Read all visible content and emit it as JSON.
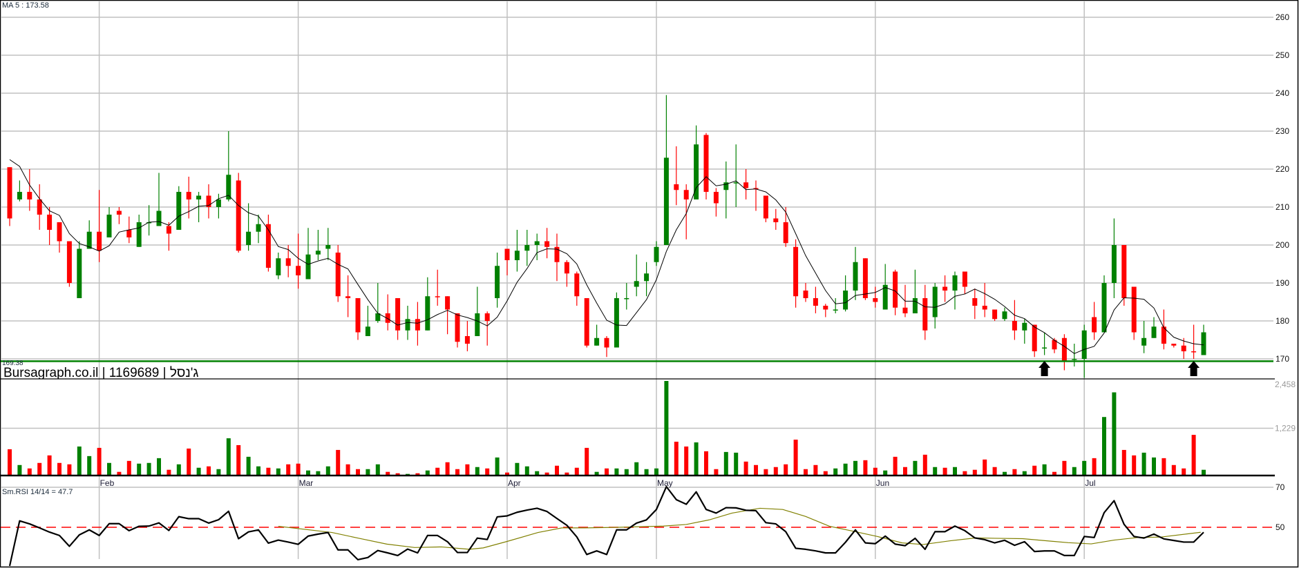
{
  "header": {
    "ma_label": "MA 5 : 173.58",
    "rsi_label": "Sm.RSI 14/14 = 47.7",
    "level_label": "169.38",
    "title": "Bursagraph.co.il | 1169689 | ג'נסל"
  },
  "colors": {
    "up": "#008000",
    "down": "#ff0000",
    "grid": "#c0c0c0",
    "ma": "#000000",
    "support": "#008000",
    "rsi": "#000000",
    "rsi_signal": "#808000",
    "rsi_ref": "#ff0000"
  },
  "chart_data": {
    "type": "candlestick",
    "price_axis": {
      "ticks": [
        170,
        180,
        190,
        200,
        210,
        220,
        230,
        240,
        250,
        260
      ],
      "range": [
        165,
        264
      ]
    },
    "volume_axis": {
      "ticks": [
        {
          "value": 1229,
          "label": "1,229"
        },
        {
          "value": 2458,
          "label": "2,458"
        }
      ],
      "range": [
        0,
        2458
      ]
    },
    "rsi_axis": {
      "ticks": [
        {
          "value": 70,
          "label": "70"
        },
        {
          "value": 50,
          "label": "50"
        }
      ],
      "reference": 50,
      "range": [
        30,
        74
      ]
    },
    "months": [
      {
        "label": "Feb",
        "index": 9
      },
      {
        "label": "Mar",
        "index": 29
      },
      {
        "label": "Apr",
        "index": 50
      },
      {
        "label": "May",
        "index": 65
      },
      {
        "label": "Jun",
        "index": 87
      },
      {
        "label": "Jul",
        "index": 108
      }
    ],
    "support_level": 169.38,
    "arrows_at_index": [
      104,
      119
    ],
    "ohlc_fields": [
      "open",
      "high",
      "low",
      "close"
    ],
    "ohlc": [
      [
        220.5,
        220.5,
        205,
        207
      ],
      [
        212,
        217,
        211.5,
        214
      ],
      [
        214,
        220,
        209,
        212
      ],
      [
        212,
        216,
        204,
        208
      ],
      [
        208,
        210,
        200,
        204
      ],
      [
        206,
        206,
        198,
        201
      ],
      [
        201,
        201,
        189,
        190
      ],
      [
        186,
        201,
        186,
        199
      ],
      [
        199,
        206.5,
        199,
        203.5
      ],
      [
        203.5,
        214.5,
        195.5,
        198.5
      ],
      [
        202,
        210,
        202,
        208
      ],
      [
        209,
        210,
        205.5,
        208
      ],
      [
        204,
        207.5,
        200.5,
        202
      ],
      [
        199.5,
        208,
        199.5,
        206
      ],
      [
        206,
        210.5,
        202.5,
        206
      ],
      [
        205,
        219,
        205,
        209
      ],
      [
        205,
        206,
        198.5,
        203
      ],
      [
        204,
        215.5,
        204,
        214
      ],
      [
        214,
        218,
        207,
        212
      ],
      [
        212,
        214,
        206,
        213
      ],
      [
        213,
        216,
        207,
        210
      ],
      [
        210,
        213.5,
        207,
        212
      ],
      [
        212,
        230,
        211.5,
        218.5
      ],
      [
        217,
        219,
        198,
        198.5
      ],
      [
        200,
        211,
        198.5,
        203.5
      ],
      [
        203.5,
        208,
        200.5,
        205.5
      ],
      [
        205.5,
        208,
        193,
        194
      ],
      [
        192,
        198,
        191,
        196.5
      ],
      [
        196.5,
        200,
        191.5,
        194.5
      ],
      [
        194.5,
        203,
        188.5,
        192
      ],
      [
        191,
        204.5,
        191,
        197.5
      ],
      [
        197.5,
        204,
        196,
        198.5
      ],
      [
        199,
        204.5,
        196,
        200
      ],
      [
        198,
        200,
        185,
        186.5
      ],
      [
        186.5,
        192,
        181,
        186
      ],
      [
        186,
        186,
        175,
        177
      ],
      [
        176,
        184,
        176,
        178.5
      ],
      [
        180,
        190,
        179.5,
        182
      ],
      [
        182,
        187,
        177.5,
        179.5
      ],
      [
        186,
        186,
        175,
        177.5
      ],
      [
        177.5,
        184,
        175,
        180.5
      ],
      [
        180.5,
        185,
        173.5,
        177.5
      ],
      [
        177.5,
        191.5,
        177.5,
        186.5
      ],
      [
        186.5,
        193.5,
        184,
        186.4
      ],
      [
        186.5,
        186.5,
        176.5,
        183
      ],
      [
        182,
        182,
        173,
        174.5
      ],
      [
        176,
        180,
        172,
        174
      ],
      [
        176,
        189,
        176,
        182
      ],
      [
        182,
        182.5,
        173.5,
        180
      ],
      [
        186,
        198,
        183.5,
        194.5
      ],
      [
        199,
        199,
        192,
        196
      ],
      [
        196,
        204,
        193,
        198.5
      ],
      [
        198.5,
        204,
        194.5,
        200
      ],
      [
        200,
        203,
        196,
        201
      ],
      [
        201,
        204.5,
        196.5,
        199.5
      ],
      [
        199.5,
        203,
        190.5,
        195.5
      ],
      [
        195.5,
        196,
        189,
        192.5
      ],
      [
        192.5,
        193,
        184,
        186.5
      ],
      [
        186,
        186,
        173,
        173.5
      ],
      [
        173.5,
        179,
        173.5,
        175.5
      ],
      [
        175.5,
        176,
        170.5,
        173
      ],
      [
        173,
        187.5,
        173,
        186
      ],
      [
        186,
        190,
        183,
        186
      ],
      [
        189,
        197.5,
        186.5,
        190.5
      ],
      [
        190.5,
        195.5,
        186.5,
        192.5
      ],
      [
        195.5,
        201,
        194.5,
        199.5
      ],
      [
        200,
        239.5,
        200,
        223
      ],
      [
        216,
        226,
        210.5,
        214.5
      ],
      [
        214.5,
        216,
        201.5,
        212
      ],
      [
        212,
        231.5,
        212,
        226.5
      ],
      [
        229,
        229.5,
        212,
        214
      ],
      [
        214,
        215,
        207.5,
        211
      ],
      [
        214.5,
        222,
        207,
        216.5
      ],
      [
        216.5,
        226.5,
        210,
        216.5
      ],
      [
        216.5,
        220,
        212,
        215
      ],
      [
        215,
        217,
        209,
        214.9
      ],
      [
        213,
        213,
        206,
        207
      ],
      [
        207,
        209.5,
        204,
        206
      ],
      [
        206,
        210,
        199.5,
        200.5
      ],
      [
        199.5,
        201.5,
        183.5,
        186.5
      ],
      [
        188,
        190,
        185,
        186
      ],
      [
        186,
        189,
        182,
        184
      ],
      [
        184,
        184.5,
        181,
        183
      ],
      [
        183,
        186,
        182,
        183
      ],
      [
        183,
        192,
        182.5,
        188
      ],
      [
        188,
        199.5,
        185.5,
        195.5
      ],
      [
        196.5,
        196.5,
        185.5,
        186
      ],
      [
        186,
        189,
        183.5,
        185
      ],
      [
        183,
        195,
        183,
        189.5
      ],
      [
        193,
        193.5,
        181.5,
        183.5
      ],
      [
        183.5,
        189.5,
        181,
        182
      ],
      [
        182,
        193.5,
        182,
        186
      ],
      [
        186,
        189.5,
        175,
        177.5
      ],
      [
        181,
        190,
        178,
        189
      ],
      [
        189,
        192,
        185,
        188
      ],
      [
        188,
        193,
        183,
        192
      ],
      [
        193,
        193,
        187,
        189
      ],
      [
        186,
        188.5,
        180.5,
        184
      ],
      [
        184,
        190,
        181,
        183
      ],
      [
        183,
        183,
        180,
        180.5
      ],
      [
        180.5,
        183.5,
        180,
        182.5
      ],
      [
        180,
        185.5,
        175,
        177.5
      ],
      [
        177.5,
        180.5,
        174,
        179.5
      ],
      [
        179,
        179,
        170.5,
        172
      ],
      [
        173,
        177,
        171,
        173
      ],
      [
        175,
        175.5,
        171.5,
        172.5
      ],
      [
        175.5,
        176.5,
        167,
        169.5
      ],
      [
        170,
        174,
        168,
        170
      ],
      [
        170,
        179,
        165,
        177.5
      ],
      [
        181,
        185,
        175,
        177
      ],
      [
        177,
        192,
        177,
        190
      ],
      [
        190,
        207,
        186,
        200
      ],
      [
        200,
        200,
        184,
        186
      ],
      [
        189,
        189,
        175,
        177
      ],
      [
        173.5,
        180,
        171.5,
        175.5
      ],
      [
        175.5,
        181,
        175.5,
        178.5
      ],
      [
        178.5,
        183,
        172.5,
        174
      ],
      [
        174,
        174,
        173,
        173.5
      ],
      [
        173.5,
        175.5,
        170,
        172
      ],
      [
        172,
        179,
        170,
        171.9
      ],
      [
        171,
        179,
        171,
        177
      ]
    ],
    "ma5_head": [
      222.5,
      220.7,
      215.8,
      212.2
    ],
    "volume": [
      683,
      273,
      184,
      327,
      523,
      327,
      291,
      754,
      505,
      719,
      327,
      95,
      380,
      309,
      327,
      451,
      149,
      291,
      701,
      202,
      238,
      166,
      968,
      790,
      487,
      238,
      202,
      184,
      291,
      309,
      131,
      113,
      238,
      665,
      291,
      166,
      166,
      291,
      95,
      59,
      42,
      59,
      131,
      202,
      345,
      166,
      291,
      220,
      184,
      469,
      77,
      327,
      238,
      113,
      77,
      255,
      77,
      202,
      719,
      95,
      184,
      184,
      166,
      345,
      166,
      184,
      2458,
      879,
      754,
      861,
      630,
      166,
      612,
      594,
      362,
      273,
      166,
      220,
      291,
      933,
      166,
      273,
      113,
      184,
      309,
      380,
      398,
      202,
      131,
      487,
      220,
      380,
      541,
      220,
      202,
      220,
      113,
      149,
      416,
      220,
      95,
      166,
      113,
      255,
      291,
      95,
      380,
      220,
      380,
      451,
      1521,
      2162,
      665,
      523,
      594,
      469,
      451,
      273,
      184,
      1057,
      149
    ],
    "rsi": [
      30.7,
      53.2,
      51.7,
      49.7,
      47.6,
      45.9,
      40.5,
      46.2,
      48.7,
      45.9,
      51.8,
      51.8,
      48.3,
      50.5,
      50.6,
      52.2,
      48.4,
      55.3,
      54.3,
      54.3,
      52.1,
      53.8,
      58,
      44.3,
      47.7,
      48.7,
      42.1,
      43.6,
      42.6,
      41.5,
      45.6,
      46.6,
      47.4,
      38.7,
      38.7,
      33.8,
      34.9,
      38.4,
      37.2,
      35.9,
      39.1,
      37.2,
      45.9,
      45.9,
      42.8,
      37.4,
      37.4,
      44.6,
      43.9,
      55.2,
      55.7,
      57.5,
      58.6,
      59.5,
      57.9,
      54.4,
      51,
      45.2,
      36.4,
      38.2,
      36.4,
      48.7,
      48.7,
      52.1,
      53.7,
      58.9,
      70.3,
      63.8,
      61.5,
      67.7,
      58.9,
      57.1,
      59.8,
      59.7,
      58.5,
      58.3,
      52.3,
      51.7,
      47.8,
      39.5,
      39,
      38.2,
      37.2,
      37.2,
      42.5,
      48.7,
      42.2,
      41.8,
      45.6,
      41.6,
      40.8,
      44.5,
      39,
      47.8,
      47.8,
      50.6,
      48.3,
      44.7,
      43.8,
      42.2,
      43.5,
      41,
      42.8,
      37.9,
      38.2,
      38.2,
      35.9,
      35.9,
      45.4,
      44.9,
      57.3,
      63.3,
      51.5,
      45.4,
      44.6,
      46.6,
      44.2,
      43.4,
      42.6,
      42.6,
      47.5
    ],
    "rsi_signal": [
      [
        27,
        50.5
      ],
      [
        32.4,
        47.4
      ],
      [
        35.1,
        44.5
      ],
      [
        37.9,
        41.6
      ],
      [
        40.7,
        39.9
      ],
      [
        43.4,
        40.2
      ],
      [
        46.2,
        39
      ],
      [
        47.6,
        39.7
      ],
      [
        49.9,
        42.8
      ],
      [
        53.1,
        47.4
      ],
      [
        55.5,
        49.7
      ],
      [
        57.8,
        49.7
      ],
      [
        61.3,
        50
      ],
      [
        65.7,
        50.6
      ],
      [
        68,
        51.4
      ],
      [
        70.3,
        53.7
      ],
      [
        72.6,
        57.1
      ],
      [
        75.4,
        59.5
      ],
      [
        77.7,
        58.9
      ],
      [
        80,
        55.4
      ],
      [
        82.4,
        50.5
      ],
      [
        84.9,
        47.9
      ],
      [
        87.2,
        45.4
      ],
      [
        89.7,
        42.2
      ],
      [
        91.8,
        41.4
      ],
      [
        94.6,
        43.3
      ],
      [
        97.1,
        44.7
      ],
      [
        99,
        44.5
      ],
      [
        101.8,
        44.3
      ],
      [
        106.4,
        42.3
      ],
      [
        108.7,
        41.7
      ],
      [
        111,
        43.6
      ],
      [
        113.4,
        44.9
      ],
      [
        115.7,
        45.1
      ],
      [
        119.7,
        47.5
      ]
    ]
  }
}
